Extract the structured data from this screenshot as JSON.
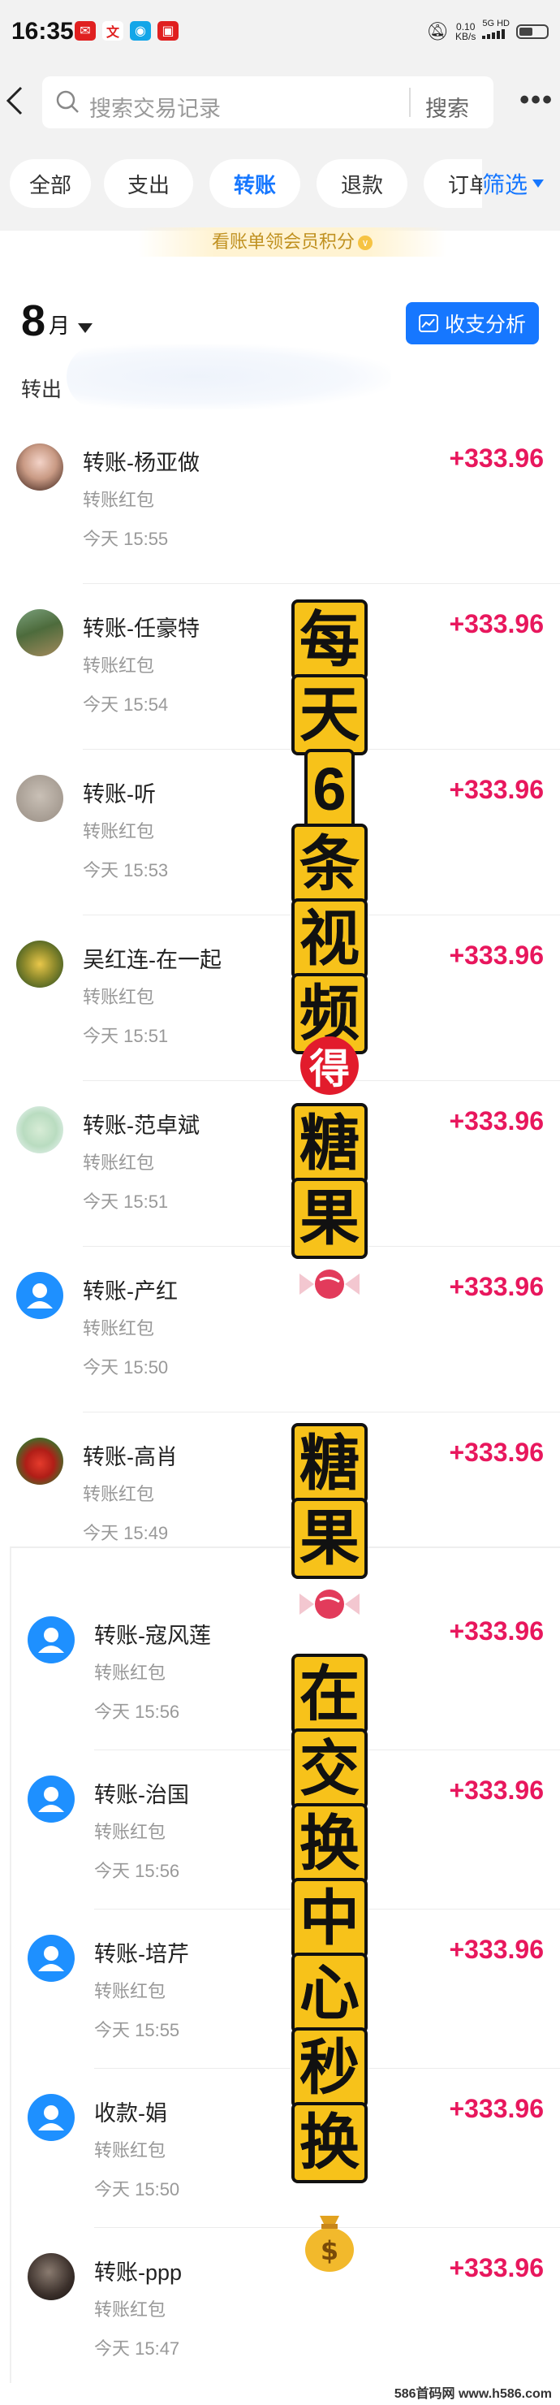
{
  "status_bar": {
    "time": "16:35",
    "net_speed_value": "0.10",
    "net_speed_unit": "KB/s",
    "signal_label": "5G HD"
  },
  "header": {
    "search_placeholder": "搜索交易记录",
    "search_button": "搜索",
    "more": "•••"
  },
  "tabs": [
    {
      "label": "全部",
      "active": false
    },
    {
      "label": "支出",
      "active": false
    },
    {
      "label": "转账",
      "active": true
    },
    {
      "label": "退款",
      "active": false
    },
    {
      "label": "订单",
      "active": false
    }
  ],
  "filter_label": "筛选",
  "member_hint": "看账单领会员积分",
  "month": {
    "number": "8",
    "unit": "月",
    "analysis_button": "收支分析",
    "transfer_out_label": "转出"
  },
  "transactions": [
    {
      "title": "转账-杨亚做",
      "subtitle": "转账红包",
      "time": "今天 15:55",
      "amount": "+333.96",
      "avatar": "photo-girl"
    },
    {
      "title": "转账-任豪特",
      "subtitle": "转账红包",
      "time": "今天 15:54",
      "amount": "+333.96",
      "avatar": "photo-scene"
    },
    {
      "title": "转账-听",
      "subtitle": "转账红包",
      "time": "今天 15:53",
      "amount": "+333.96",
      "avatar": "photo-gray"
    },
    {
      "title": "吴红连-在一起",
      "subtitle": "转账红包",
      "time": "今天 15:51",
      "amount": "+333.96",
      "avatar": "photo-flower"
    },
    {
      "title": "转账-范卓斌",
      "subtitle": "转账红包",
      "time": "今天 15:51",
      "amount": "+333.96",
      "avatar": "photo-light"
    },
    {
      "title": "转账-产红",
      "subtitle": "转账红包",
      "time": "今天 15:50",
      "amount": "+333.96",
      "avatar": "default"
    },
    {
      "title": "转账-高肖",
      "subtitle": "转账红包",
      "time": "今天 15:49",
      "amount": "+333.96",
      "avatar": "photo-gift"
    },
    {
      "title": "转账-寇风莲",
      "subtitle": "转账红包",
      "time": "今天 15:56",
      "amount": "+333.96",
      "avatar": "default"
    },
    {
      "title": "转账-治国",
      "subtitle": "转账红包",
      "time": "今天 15:56",
      "amount": "+333.96",
      "avatar": "default"
    },
    {
      "title": "转账-培芹",
      "subtitle": "转账红包",
      "time": "今天 15:55",
      "amount": "+333.96",
      "avatar": "default"
    },
    {
      "title": "收款-娟",
      "subtitle": "转账红包",
      "time": "今天 15:50",
      "amount": "+333.96",
      "avatar": "default"
    },
    {
      "title": "转账-ppp",
      "subtitle": "转账红包",
      "time": "今天 15:47",
      "amount": "+333.96",
      "avatar": "photo-dark"
    }
  ],
  "promo": {
    "part1": [
      "每",
      "天",
      "6",
      "条",
      "视",
      "频"
    ],
    "badge": "得",
    "part2": [
      "糖",
      "果"
    ],
    "part3": [
      "糖",
      "果"
    ],
    "part4": [
      "在",
      "交",
      "换",
      "中",
      "心",
      "秒",
      "换"
    ]
  },
  "watermark": "586首码网 www.h586.com",
  "colors": {
    "accent": "#1677ff",
    "amount": "#e8175d",
    "promo_bg": "#f7c21a"
  }
}
